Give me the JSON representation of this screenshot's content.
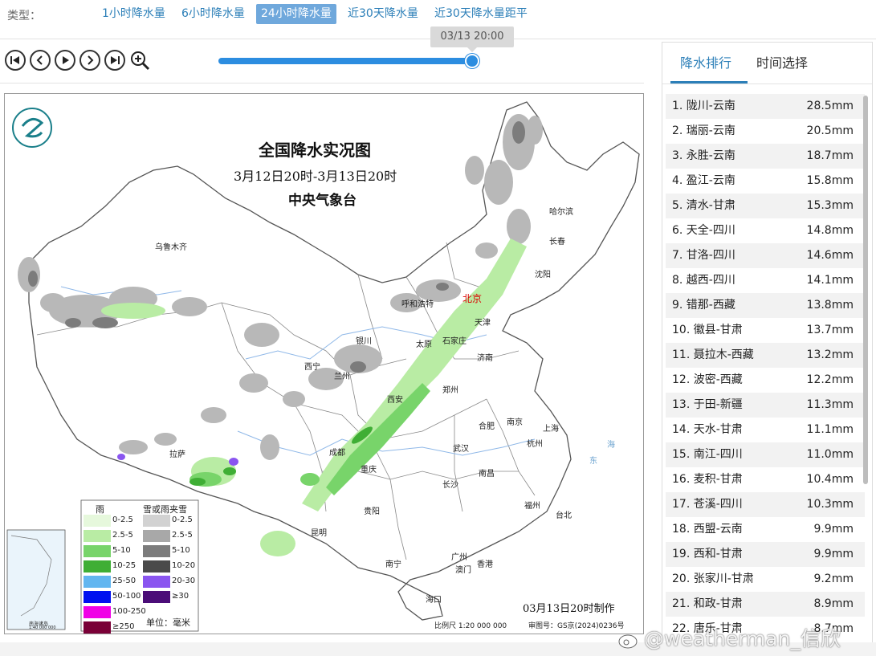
{
  "type_bar": {
    "label": "类型：",
    "tabs": [
      {
        "label": "1小时降水量",
        "active": false
      },
      {
        "label": "6小时降水量",
        "active": false
      },
      {
        "label": "24小时降水量",
        "active": true
      },
      {
        "label": "近30天降水量",
        "active": false
      },
      {
        "label": "近30天降水量距平",
        "active": false
      }
    ]
  },
  "player": {
    "time_tip": "03/13 20:00",
    "progress": 1.0,
    "controls": [
      "skip-start-icon",
      "step-back-icon",
      "play-icon",
      "step-forward-icon",
      "skip-end-icon",
      "zoom-in-icon"
    ]
  },
  "map": {
    "title": "全国降水实况图",
    "period": "3月12日20时-3月13日20时",
    "agency": "中央气象台",
    "made_time": "03月13日20时制作",
    "scale": "比例尺 1:20 000 000",
    "review_no": "审图号：GS京(2024)0236号",
    "inset_label1": "南海诸岛",
    "inset_label2": "1:40 000 000",
    "sea_east": "东",
    "sea_sea": "海",
    "cities": [
      {
        "key": "urumqi",
        "name": "乌鲁木齐"
      },
      {
        "key": "harbin",
        "name": "哈尔滨"
      },
      {
        "key": "changchun",
        "name": "长春"
      },
      {
        "key": "shenyang",
        "name": "沈阳"
      },
      {
        "key": "hohhot",
        "name": "呼和浩特"
      },
      {
        "key": "beijing",
        "name": "北京"
      },
      {
        "key": "tianjin",
        "name": "天津"
      },
      {
        "key": "yinchuan",
        "name": "银川"
      },
      {
        "key": "taiyuan",
        "name": "太原"
      },
      {
        "key": "shijiazhuang",
        "name": "石家庄"
      },
      {
        "key": "xining",
        "name": "西宁"
      },
      {
        "key": "lanzhou",
        "name": "兰州"
      },
      {
        "key": "jinan",
        "name": "济南"
      },
      {
        "key": "zhengzhou",
        "name": "郑州"
      },
      {
        "key": "xian",
        "name": "西安"
      },
      {
        "key": "hefei",
        "name": "合肥"
      },
      {
        "key": "nanjing",
        "name": "南京"
      },
      {
        "key": "shanghai",
        "name": "上海"
      },
      {
        "key": "lhasa",
        "name": "拉萨"
      },
      {
        "key": "chengdu",
        "name": "成都"
      },
      {
        "key": "wuhan",
        "name": "武汉"
      },
      {
        "key": "hangzhou",
        "name": "杭州"
      },
      {
        "key": "chongqing",
        "name": "重庆"
      },
      {
        "key": "changsha",
        "name": "长沙"
      },
      {
        "key": "nanchang",
        "name": "南昌"
      },
      {
        "key": "guiyang",
        "name": "贵阳"
      },
      {
        "key": "fuzhou",
        "name": "福州"
      },
      {
        "key": "taibei",
        "name": "台北"
      },
      {
        "key": "kunming",
        "name": "昆明"
      },
      {
        "key": "nanning",
        "name": "南宁"
      },
      {
        "key": "guangzhou",
        "name": "广州"
      },
      {
        "key": "aomen",
        "name": "澳门"
      },
      {
        "key": "xianggang",
        "name": "香港"
      },
      {
        "key": "haikou",
        "name": "海口"
      }
    ],
    "legend": {
      "rain_title": "雨",
      "snow_title": "雪或雨夹雪",
      "unit": "单位：毫米",
      "rain": [
        {
          "label": "0-2.5",
          "color": "#e6f8dc"
        },
        {
          "label": "2.5-5",
          "color": "#b9eca4"
        },
        {
          "label": "5-10",
          "color": "#78d46a"
        },
        {
          "label": "10-25",
          "color": "#3fae35"
        },
        {
          "label": "25-50",
          "color": "#62b6f0"
        },
        {
          "label": "50-100",
          "color": "#0010f0"
        },
        {
          "label": "100-250",
          "color": "#f000e6"
        },
        {
          "label": "≥250",
          "color": "#7a0037"
        }
      ],
      "snow": [
        {
          "label": "0-2.5",
          "color": "#d2d2d2"
        },
        {
          "label": "2.5-5",
          "color": "#a8a8a8"
        },
        {
          "label": "5-10",
          "color": "#7c7c7c"
        },
        {
          "label": "10-20",
          "color": "#4a4a4a"
        },
        {
          "label": "20-30",
          "color": "#8a55f0"
        },
        {
          "label": "≥30",
          "color": "#4b0d78"
        }
      ]
    }
  },
  "panel": {
    "tabs": [
      {
        "label": "降水排行",
        "active": true
      },
      {
        "label": "时间选择",
        "active": false
      }
    ],
    "ranking": [
      {
        "name": "1. 陇川-云南",
        "value": "28.5mm"
      },
      {
        "name": "2. 瑞丽-云南",
        "value": "20.5mm"
      },
      {
        "name": "3. 永胜-云南",
        "value": "18.7mm"
      },
      {
        "name": "4. 盈江-云南",
        "value": "15.8mm"
      },
      {
        "name": "5. 清水-甘肃",
        "value": "15.3mm"
      },
      {
        "name": "6. 天全-四川",
        "value": "14.8mm"
      },
      {
        "name": "7. 甘洛-四川",
        "value": "14.6mm"
      },
      {
        "name": "8. 越西-四川",
        "value": "14.1mm"
      },
      {
        "name": "9. 错那-西藏",
        "value": "13.8mm"
      },
      {
        "name": "10. 徽县-甘肃",
        "value": "13.7mm"
      },
      {
        "name": "11. 聂拉木-西藏",
        "value": "13.2mm"
      },
      {
        "name": "12. 波密-西藏",
        "value": "12.2mm"
      },
      {
        "name": "13. 于田-新疆",
        "value": "11.3mm"
      },
      {
        "name": "14. 天水-甘肃",
        "value": "11.1mm"
      },
      {
        "name": "15. 南江-四川",
        "value": "11.0mm"
      },
      {
        "name": "16. 麦积-甘肃",
        "value": "10.4mm"
      },
      {
        "name": "17. 苍溪-四川",
        "value": "10.3mm"
      },
      {
        "name": "18. 西盟-云南",
        "value": "9.9mm"
      },
      {
        "name": "19. 西和-甘肃",
        "value": "9.9mm"
      },
      {
        "name": "20. 张家川-甘肃",
        "value": "9.2mm"
      },
      {
        "name": "21. 和政-甘肃",
        "value": "8.9mm"
      },
      {
        "name": "22. 唐乐-甘肃",
        "value": "8.7mm"
      }
    ]
  },
  "watermark": "@weatherman_信欣"
}
